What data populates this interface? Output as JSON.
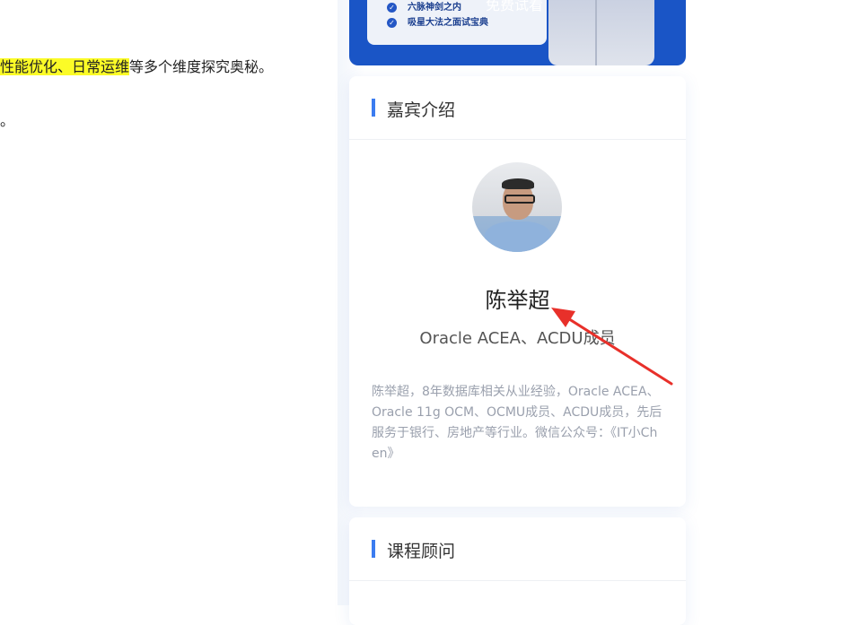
{
  "article": {
    "line1_highlight": "性能优化、日常运维",
    "line1_rest": "等多个维度探究奥秘。",
    "line2": "。"
  },
  "banner": {
    "bullet1": "六脉神剑之内",
    "bullet2": "吸星大法之面试宝典",
    "trial_label": "免费试看"
  },
  "guest_card": {
    "title": "嘉宾介绍",
    "name": "陈举超",
    "role": "Oracle ACEA、ACDU成员",
    "bio": "陈举超，8年数据库相关从业经验，Oracle ACEA、Oracle 11g OCM、OCMU成员、ACDU成员，先后服务于银行、房地产等行业。微信公众号：《IT小Chen》"
  },
  "advisor_card": {
    "title": "课程顾问"
  },
  "colors": {
    "accent_bar": "#3b7cf0",
    "banner_blue": "#1a55c6",
    "highlight": "#fbfb27",
    "annotation_arrow": "#e8302a"
  }
}
